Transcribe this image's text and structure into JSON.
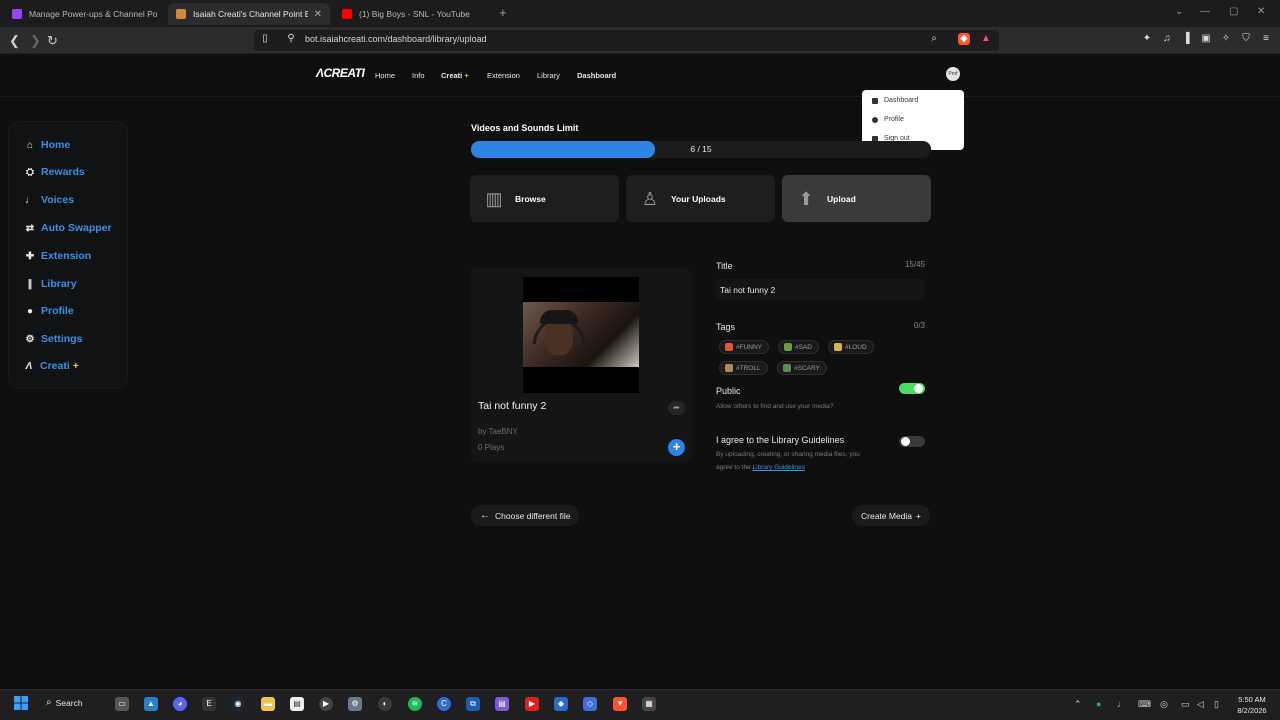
{
  "browser": {
    "tabs": [
      {
        "title": "Manage Power-ups & Channel Points",
        "favicon_color": "#9146ff"
      },
      {
        "title": "Isaiah Creati's Channel Point Bot",
        "favicon_color": "#d08a3a"
      },
      {
        "title": "(1) Big Boys - SNL - YouTube",
        "favicon_color": "#ff0000"
      }
    ],
    "url": "bot.isaiahcreati.com/dashboard/library/upload"
  },
  "site": {
    "logo": "ΛCREATI",
    "nav": [
      "Home",
      "Info",
      "Creati",
      "Extension",
      "Library",
      "Dashboard"
    ],
    "nav_plus": "+",
    "avatar_text": "Prof"
  },
  "dropdown": {
    "items": [
      "Dashboard",
      "Profile",
      "Sign out"
    ]
  },
  "sidebar": {
    "items": [
      {
        "label": "Home",
        "icon": "home-icon",
        "glyph": "⌂"
      },
      {
        "label": "Rewards",
        "icon": "rewards-icon",
        "glyph": "⛭"
      },
      {
        "label": "Voices",
        "icon": "microphone-icon",
        "glyph": "♩"
      },
      {
        "label": "Auto Swapper",
        "icon": "swap-icon",
        "glyph": "⇄"
      },
      {
        "label": "Extension",
        "icon": "extension-icon",
        "glyph": "✚"
      },
      {
        "label": "Library",
        "icon": "library-icon",
        "glyph": "∥"
      },
      {
        "label": "Profile",
        "icon": "profile-icon",
        "glyph": "●"
      },
      {
        "label": "Settings",
        "icon": "settings-icon",
        "glyph": "⚙"
      },
      {
        "label": "Creati",
        "icon": "creati-logo-icon",
        "glyph": "Λ",
        "plus": "+"
      }
    ]
  },
  "main": {
    "limit_title": "Videos and Sounds Limit",
    "limit_used": 6,
    "limit_total": 15,
    "limit_label": "6 / 15",
    "categories": [
      {
        "label": "Browse",
        "icon": "books-icon",
        "glyph": "▥"
      },
      {
        "label": "Your Uploads",
        "icon": "user-icon",
        "glyph": "♙"
      },
      {
        "label": "Upload",
        "icon": "upload-icon",
        "glyph": "⬆"
      }
    ],
    "preview": {
      "title": "Tai not funny 2",
      "by": "by TaeBNY",
      "plays": "0 Plays"
    },
    "form": {
      "title_label": "Title",
      "title_counter": "15/45",
      "title_value": "Tai not funny 2",
      "tags_label": "Tags",
      "tags_counter": "0/3",
      "tags": [
        {
          "label": "#FUNNY",
          "color": "#e0533c"
        },
        {
          "label": "#SAD",
          "color": "#6a9b3c"
        },
        {
          "label": "#LOUD",
          "color": "#d9b44a"
        },
        {
          "label": "#TROLL",
          "color": "#b08a52"
        },
        {
          "label": "#SCARY",
          "color": "#5a8a5a"
        }
      ],
      "public_label": "Public",
      "public_desc": "Allow others to find and use your media?",
      "public_on": true,
      "agree_label": "I agree to the Library Guidelines",
      "agree_desc_1": "By uploading, creating, or sharing media files, you",
      "agree_desc_2": "agree to the",
      "agree_link": "Library Guidelines",
      "agree_on": false
    },
    "choose_file_label": "Choose different file",
    "create_label": "Create Media",
    "back_arrow": "←",
    "create_plus": "+"
  },
  "taskbar": {
    "search_label": "Search",
    "time": "5:50 AM",
    "date": "8/2/2026"
  },
  "colors": {
    "accent": "#2e83e3",
    "link": "#3d8fe6",
    "toggle_on": "#4cd964"
  }
}
